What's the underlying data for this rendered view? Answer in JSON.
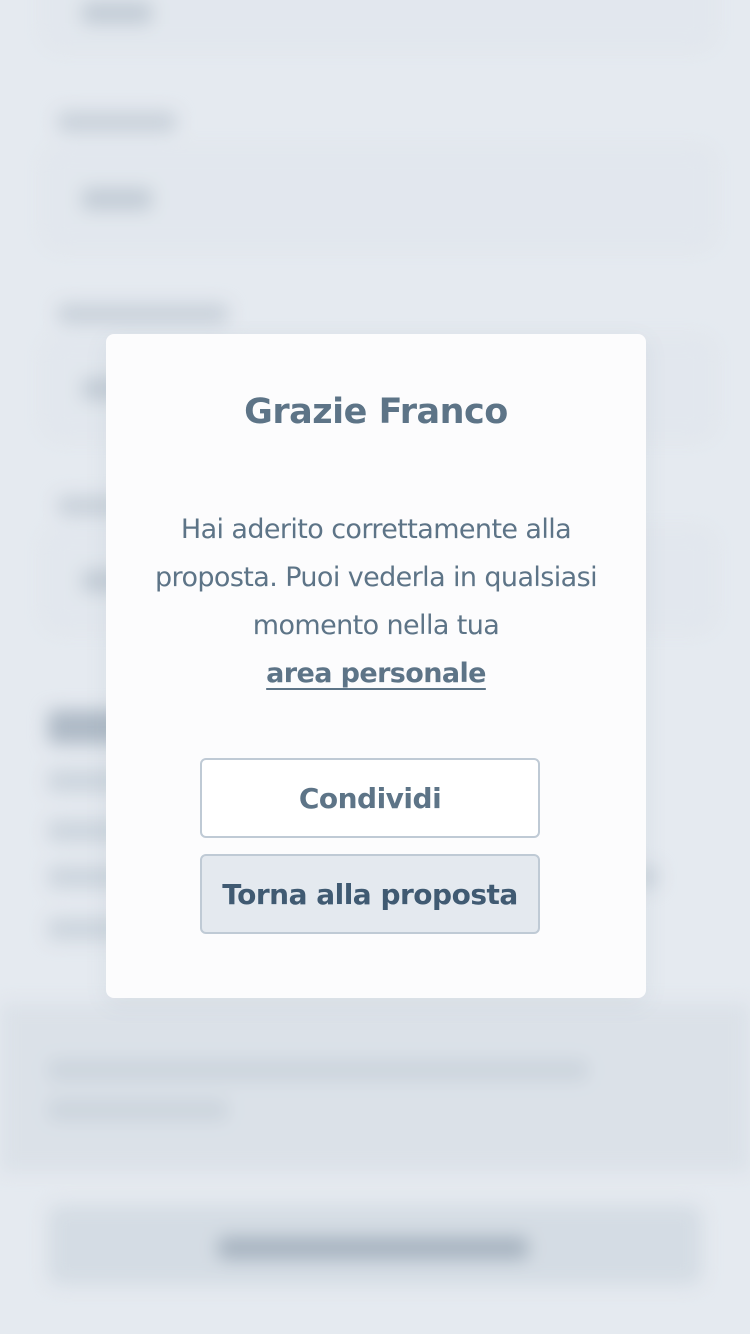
{
  "modal": {
    "title": "Grazie Franco",
    "message": "Hai aderito correttamente alla proposta. Puoi vederla in qualsiasi momento nella tua",
    "link_label": "area personale",
    "share_button": "Condividi",
    "back_button": "Torna alla proposta"
  },
  "colors": {
    "text": "#5d7487",
    "primary_button_text": "#405a72",
    "modal_background": "#fcfcfd",
    "backdrop": "#e3e8ef"
  }
}
